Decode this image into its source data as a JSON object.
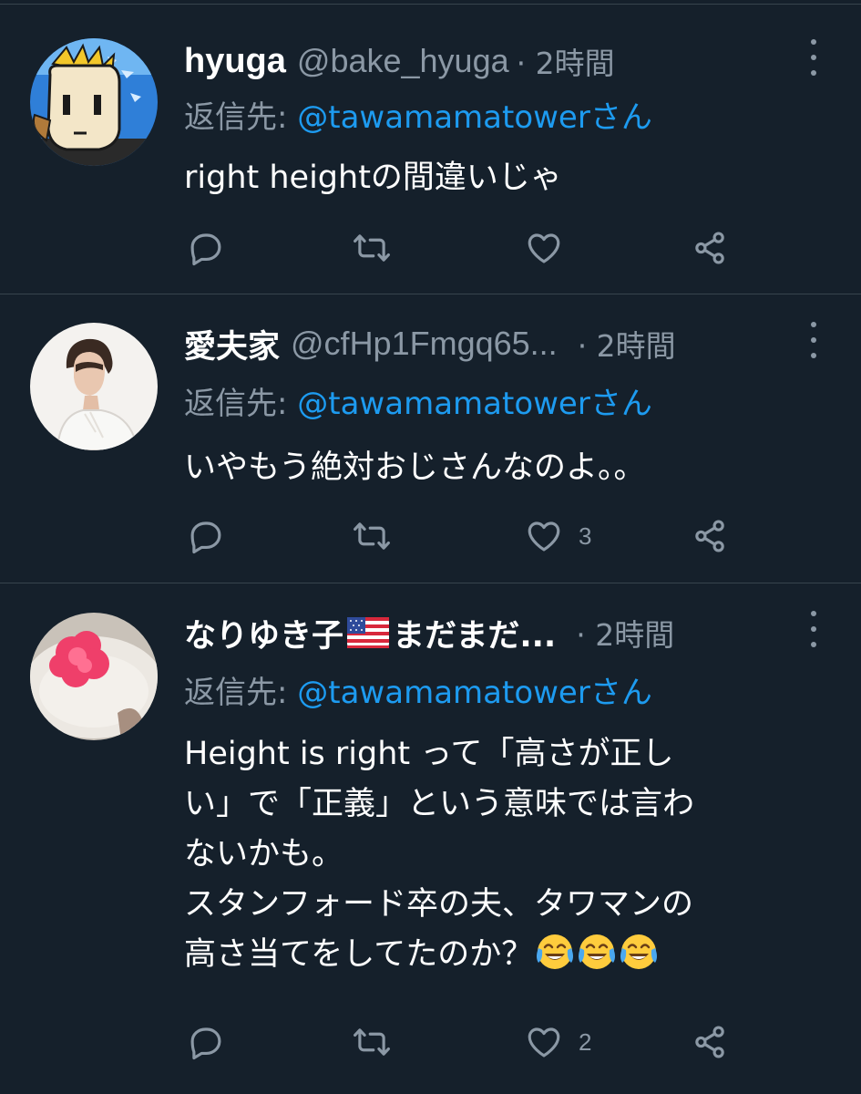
{
  "colors": {
    "background": "#15202b",
    "divider": "#38444d",
    "secondary_text": "#8b98a5",
    "mention": "#1d9bf0"
  },
  "replies": [
    {
      "display_name": "hyuga",
      "handle": "@bake_hyuga",
      "time": "· 2時間",
      "replying_label": "返信先: ",
      "replying_to": "@tawamamatowerさん",
      "text": "right heightの間違いじゃ",
      "like_count": ""
    },
    {
      "display_name": "愛夫家",
      "handle": "@cfHp1Fmgq65...",
      "time": "· 2時間",
      "replying_label": "返信先: ",
      "replying_to": "@tawamamatowerさん",
      "text": "いやもう絶対おじさんなのよ。。",
      "like_count": "3"
    },
    {
      "display_name": "なりゆき子",
      "display_name_suffix": "まだまだ...",
      "name_emoji": "us-flag-icon",
      "handle": "",
      "time": "· 2時間",
      "replying_label": "返信先: ",
      "replying_to": "@tawamamatowerさん",
      "text": "Height is right って「高さが正し\nい」で「正義」という意味では言わ\nないかも。\nスタンフォード卒の夫、タワマンの\n高さ当てをしてたのか？",
      "text_emoji": [
        "face-with-tears-of-joy-icon",
        "face-with-tears-of-joy-icon",
        "face-with-tears-of-joy-icon"
      ],
      "like_count": "2"
    }
  ],
  "icons": {
    "reply": "comment-icon",
    "retweet": "retweet-icon",
    "like": "heart-icon",
    "share": "share-icon",
    "more": "more-vertical-icon"
  }
}
